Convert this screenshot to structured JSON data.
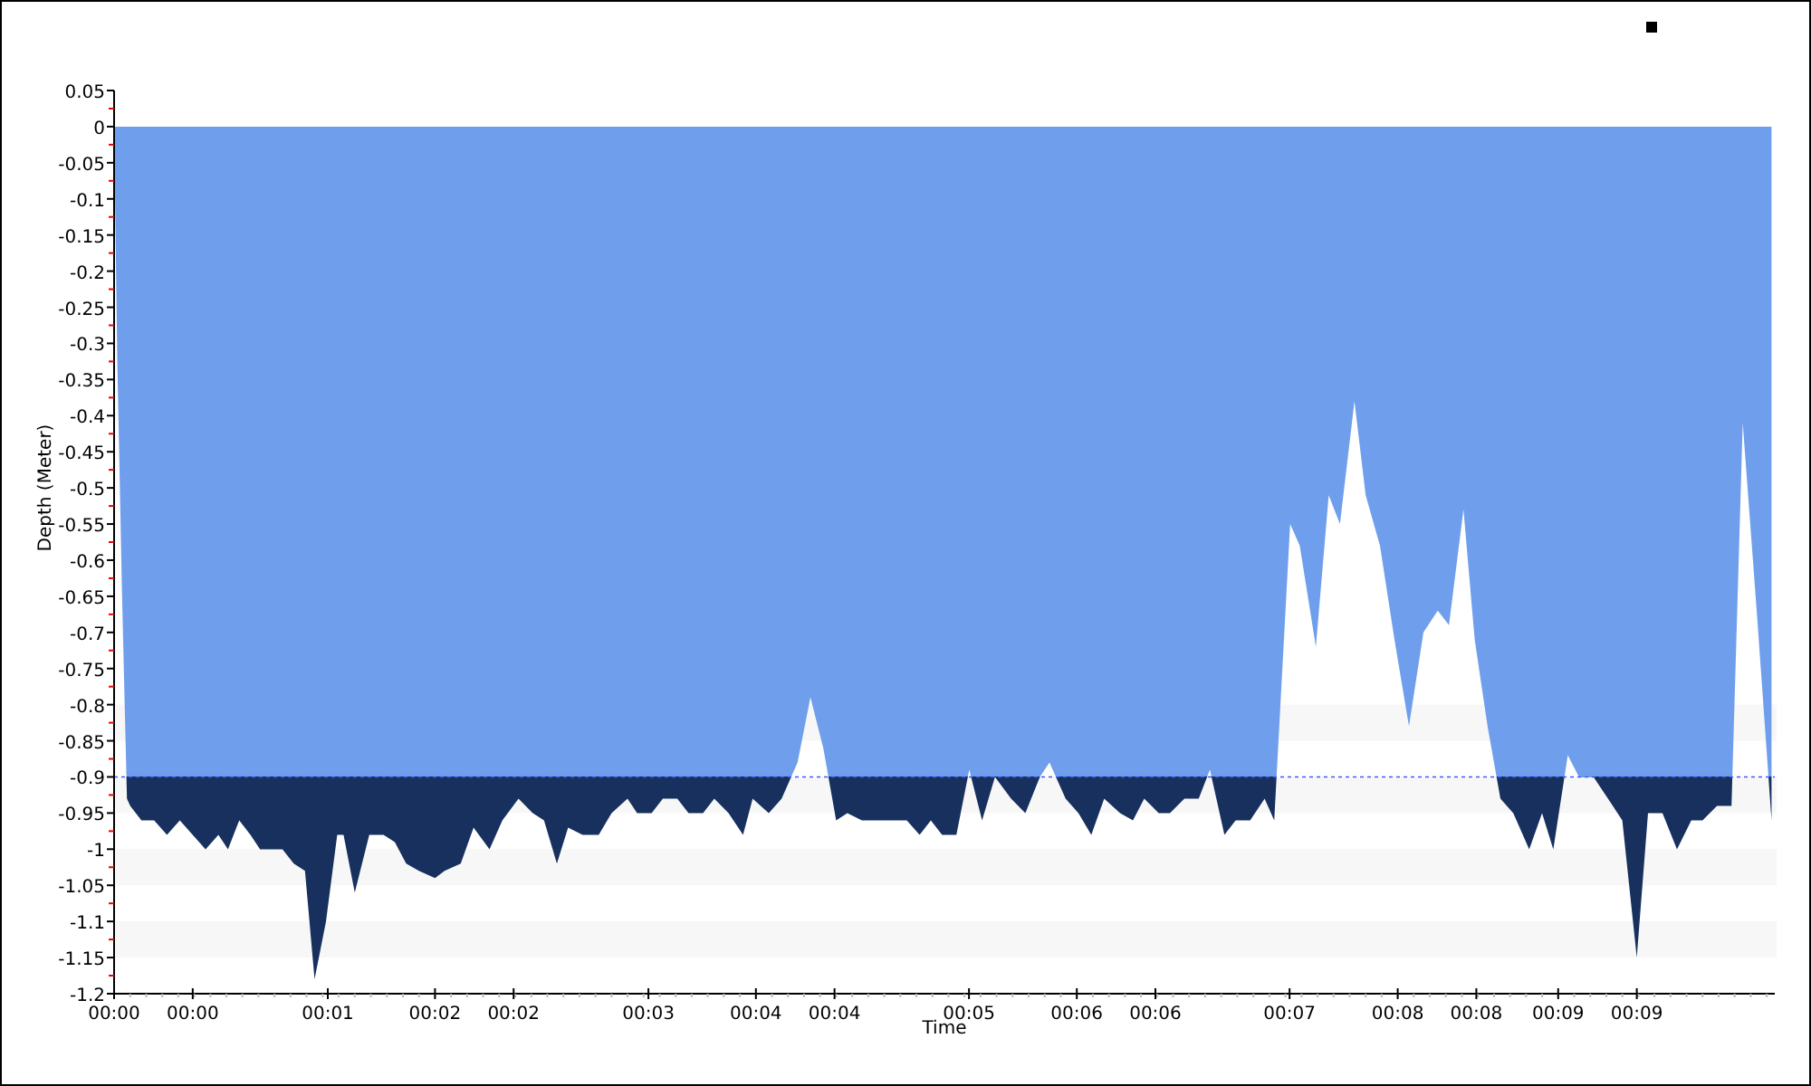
{
  "chart": {
    "chart_data": {
      "type": "area",
      "xlabel": "Time",
      "ylabel": "Depth (Meter)",
      "x": [
        0,
        0.02,
        0.05,
        0.08,
        0.1,
        0.17,
        0.25,
        0.33,
        0.41,
        0.49,
        0.57,
        0.65,
        0.71,
        0.78,
        0.85,
        0.91,
        0.98,
        1.05,
        1.12,
        1.19,
        1.25,
        1.32,
        1.39,
        1.43,
        1.5,
        1.59,
        1.68,
        1.75,
        1.82,
        1.9,
        2.0,
        2.06,
        2.16,
        2.24,
        2.34,
        2.42,
        2.52,
        2.61,
        2.68,
        2.76,
        2.83,
        2.92,
        3.02,
        3.1,
        3.2,
        3.26,
        3.35,
        3.42,
        3.51,
        3.58,
        3.67,
        3.74,
        3.83,
        3.92,
        3.98,
        4.08,
        4.16,
        4.26,
        4.34,
        4.42,
        4.5,
        4.57,
        4.66,
        4.76,
        4.84,
        4.94,
        5.02,
        5.09,
        5.16,
        5.25,
        5.33,
        5.41,
        5.49,
        5.59,
        5.68,
        5.77,
        5.83,
        5.93,
        6.01,
        6.09,
        6.17,
        6.27,
        6.35,
        6.42,
        6.51,
        6.58,
        6.67,
        6.76,
        6.83,
        6.92,
        6.99,
        7.08,
        7.17,
        7.23,
        7.33,
        7.39,
        7.49,
        7.57,
        7.64,
        7.73,
        7.8,
        7.89,
        7.98,
        8.07,
        8.16,
        8.25,
        8.32,
        8.41,
        8.48,
        8.56,
        8.64,
        8.72,
        8.82,
        8.9,
        8.97,
        9.06,
        9.13,
        9.22,
        9.31,
        9.4,
        9.49,
        9.56,
        9.65,
        9.74,
        9.83,
        9.9,
        9.99,
        10.08,
        10.15,
        10.24,
        10.33
      ],
      "series": [
        {
          "color": "#6f9fec",
          "values": [
            0,
            -0.33,
            -0.65,
            -0.93,
            -0.94,
            -0.96,
            -0.96,
            -0.98,
            -0.96,
            -0.98,
            -1.0,
            -0.98,
            -1.0,
            -0.96,
            -0.98,
            -1.0,
            -1.0,
            -1.0,
            -1.02,
            -1.03,
            -1.18,
            -1.1,
            -0.98,
            -0.98,
            -1.06,
            -0.98,
            -0.98,
            -0.99,
            -1.02,
            -1.03,
            -1.04,
            -1.03,
            -1.02,
            -0.97,
            -1.0,
            -0.96,
            -0.93,
            -0.95,
            -0.96,
            -1.02,
            -0.97,
            -0.98,
            -0.98,
            -0.95,
            -0.93,
            -0.95,
            -0.95,
            -0.93,
            -0.93,
            -0.95,
            -0.95,
            -0.93,
            -0.95,
            -0.98,
            -0.93,
            -0.95,
            -0.93,
            -0.88,
            -0.79,
            -0.86,
            -0.96,
            -0.95,
            -0.96,
            -0.96,
            -0.96,
            -0.96,
            -0.98,
            -0.96,
            -0.98,
            -0.98,
            -0.89,
            -0.96,
            -0.9,
            -0.93,
            -0.95,
            -0.9,
            -0.88,
            -0.93,
            -0.95,
            -0.98,
            -0.93,
            -0.95,
            -0.96,
            -0.93,
            -0.95,
            -0.95,
            -0.93,
            -0.93,
            -0.89,
            -0.98,
            -0.96,
            -0.96,
            -0.93,
            -0.96,
            -0.55,
            -0.58,
            -0.72,
            -0.51,
            -0.55,
            -0.38,
            -0.51,
            -0.58,
            -0.71,
            -0.83,
            -0.7,
            -0.67,
            -0.69,
            -0.53,
            -0.71,
            -0.83,
            -0.93,
            -0.95,
            -1.0,
            -0.95,
            -1.0,
            -0.87,
            -0.9,
            -0.9,
            -0.93,
            -0.96,
            -1.15,
            -0.95,
            -0.95,
            -1.0,
            -0.96,
            -0.96,
            -0.94,
            -0.94,
            -0.41,
            -0.68,
            -0.96
          ]
        }
      ],
      "xlim": [
        0,
        10.35
      ],
      "ylim": [
        -1.2,
        0.05
      ],
      "xticks": [
        {
          "value": 0,
          "label": "00:00"
        },
        {
          "value": 0.49,
          "label": "00:00"
        },
        {
          "value": 1.332,
          "label": "00:01"
        },
        {
          "value": 2.0,
          "label": "00:02"
        },
        {
          "value": 2.49,
          "label": "00:02"
        },
        {
          "value": 3.33,
          "label": "00:03"
        },
        {
          "value": 4.0,
          "label": "00:04"
        },
        {
          "value": 4.49,
          "label": "00:04"
        },
        {
          "value": 5.328,
          "label": "00:05"
        },
        {
          "value": 6.0,
          "label": "00:06"
        },
        {
          "value": 6.49,
          "label": "00:06"
        },
        {
          "value": 7.326,
          "label": "00:07"
        },
        {
          "value": 8.0,
          "label": "00:08"
        },
        {
          "value": 8.49,
          "label": "00:08"
        },
        {
          "value": 9.0,
          "label": "00:09"
        },
        {
          "value": 9.49,
          "label": "00:09"
        }
      ],
      "yticks": [
        0.05,
        0,
        -0.05,
        -0.1,
        -0.15,
        -0.2,
        -0.25,
        -0.3,
        -0.35,
        -0.4,
        -0.45,
        -0.5,
        -0.55,
        -0.6,
        -0.65,
        -0.7,
        -0.75,
        -0.8,
        -0.85,
        -0.9,
        -0.95,
        -1,
        -1.05,
        -1.1,
        -1.15,
        -1.2
      ],
      "ref_lines": [
        {
          "axis": "y",
          "value": -0.9,
          "color": "#3a5bff"
        }
      ]
    }
  }
}
